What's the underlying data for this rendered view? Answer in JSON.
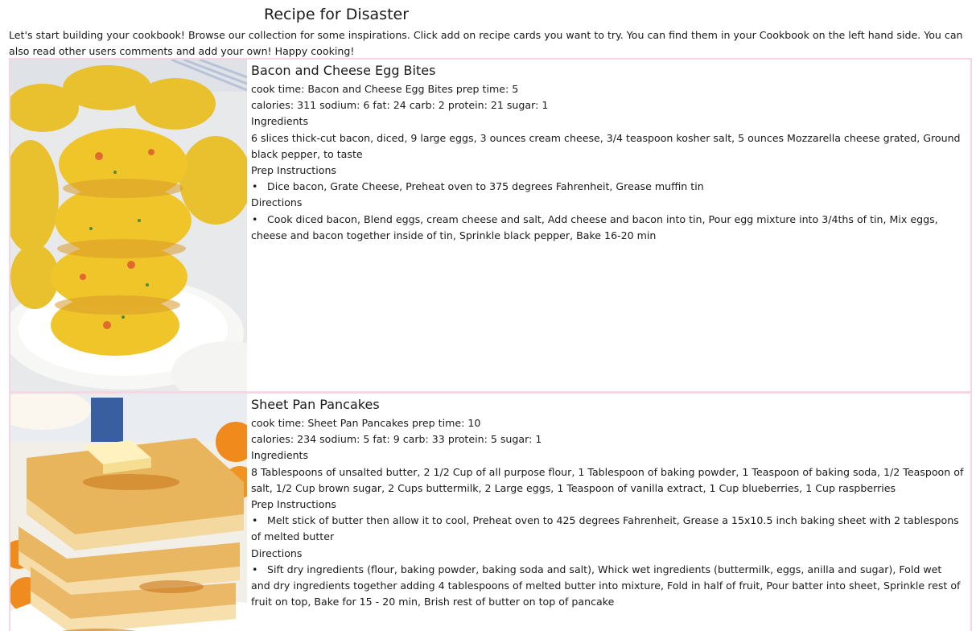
{
  "header": {
    "title": "Recipe for Disaster",
    "intro": "Let's start building your cookbook! Browse our collection for some inspirations. Click add on recipe cards you want to try. You can find them in your Cookbook on the left hand side. You can also read other users comments and add your own! Happy cooking!"
  },
  "recipes": [
    {
      "name": "Bacon and Cheese Egg Bites",
      "times": "cook time: Bacon and Cheese Egg Bites prep time: 5",
      "nutrition": "calories: 311 sodium: 6 fat: 24 carb: 2 protein: 21 sugar: 1",
      "ingredients_heading": "Ingredients",
      "ingredients": "6 slices thick-cut bacon, diced, 9 large eggs, 3 ounces cream cheese, 3/4 teaspoon kosher salt, 5 ounces Mozzarella cheese grated, Ground black pepper, to taste",
      "prep_heading": "Prep Instructions",
      "prep": "Dice bacon, Grate Cheese, Preheat oven to 375 degrees Fahrenheit, Grease muffin tin",
      "directions_heading": "Directions",
      "directions": "Cook diced bacon, Blend eggs, cream cheese and salt, Add cheese and bacon into tin, Pour egg mixture into 3/4ths of tin, Mix eggs, cheese and bacon together inside of tin, Sprinkle black pepper, Bake 16-20 min",
      "bullet": "•"
    },
    {
      "name": "Sheet Pan Pancakes",
      "times": "cook time: Sheet Pan Pancakes prep time: 10",
      "nutrition": "calories: 234 sodium: 5 fat: 9 carb: 33 protein: 5 sugar: 1",
      "ingredients_heading": "Ingredients",
      "ingredients": "8 Tablespoons of unsalted butter, 2 1/2 Cup of all purpose flour, 1 Tablespoon of baking powder, 1 Teaspoon of baking soda, 1/2 Teaspoon of salt, 1/2 Cup brown sugar, 2 Cups buttermilk, 2 Large eggs, 1 Teaspoon of vanilla extract, 1 Cup blueberries, 1 Cup raspberries",
      "prep_heading": "Prep Instructions",
      "prep": "Melt stick of butter then allow it to cool, Preheat oven to 425 degrees Fahrenheit, Grease a 15x10.5 inch baking sheet with 2 tablespons of melted butter",
      "directions_heading": "Directions",
      "directions": "Sift dry ingredients (flour, baking powder, baking soda and salt), Whick wet ingredients (buttermilk, eggs, anilla and sugar), Fold wet and dry ingredients together adding 4 tablespoons of melted butter into mixture, Fold in half of fruit, Pour batter into sheet, Sprinkle rest of fruit on top, Bake for 15 - 20 min, Brish rest of butter on top of pancake",
      "bullet": "•"
    }
  ],
  "colors": {
    "card_border": "#f6d6e4",
    "text": "#1a1a1a"
  }
}
